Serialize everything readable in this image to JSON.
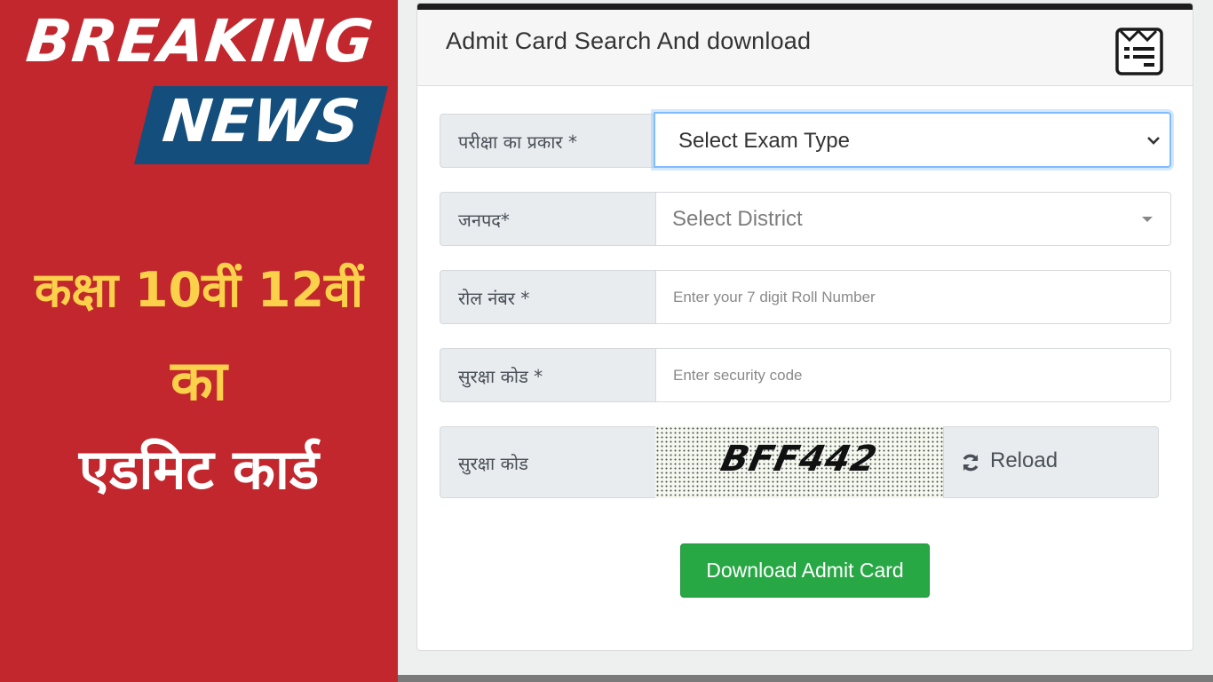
{
  "banner": {
    "headline_top": "BREAKING",
    "headline_bottom": "NEWS",
    "line1": "कक्षा 10वीं 12वीं",
    "line2": "का",
    "line3": "एडमिट कार्ड",
    "colors": {
      "background": "#c1272d",
      "news_box": "#134e7c",
      "highlight_text": "#fbd14b",
      "text": "#ffffff"
    }
  },
  "card": {
    "title": "Admit Card Search And download",
    "header_icon": "admit-card-icon",
    "fields": [
      {
        "label": "परीक्षा का प्रकार *",
        "type": "select",
        "value": "Select Exam Type",
        "icon": "chevron-down-icon"
      },
      {
        "label": "जनपद*",
        "type": "select",
        "value": "Select District",
        "icon": "caret-down-icon"
      },
      {
        "label": "रोल नंबर *",
        "type": "text",
        "value": "",
        "placeholder": "Enter your 7 digit Roll Number"
      },
      {
        "label": "सुरक्षा कोड *",
        "type": "text",
        "value": "",
        "placeholder": "Enter security code"
      }
    ],
    "captcha": {
      "label": "सुरक्षा कोड",
      "code": "BFF442",
      "reload_label": "Reload",
      "reload_icon": "refresh-icon"
    },
    "submit_label": "Download Admit Card",
    "colors": {
      "submit": "#28a745",
      "focus": "#80bdff",
      "topbar": "#1e1e1e"
    }
  }
}
